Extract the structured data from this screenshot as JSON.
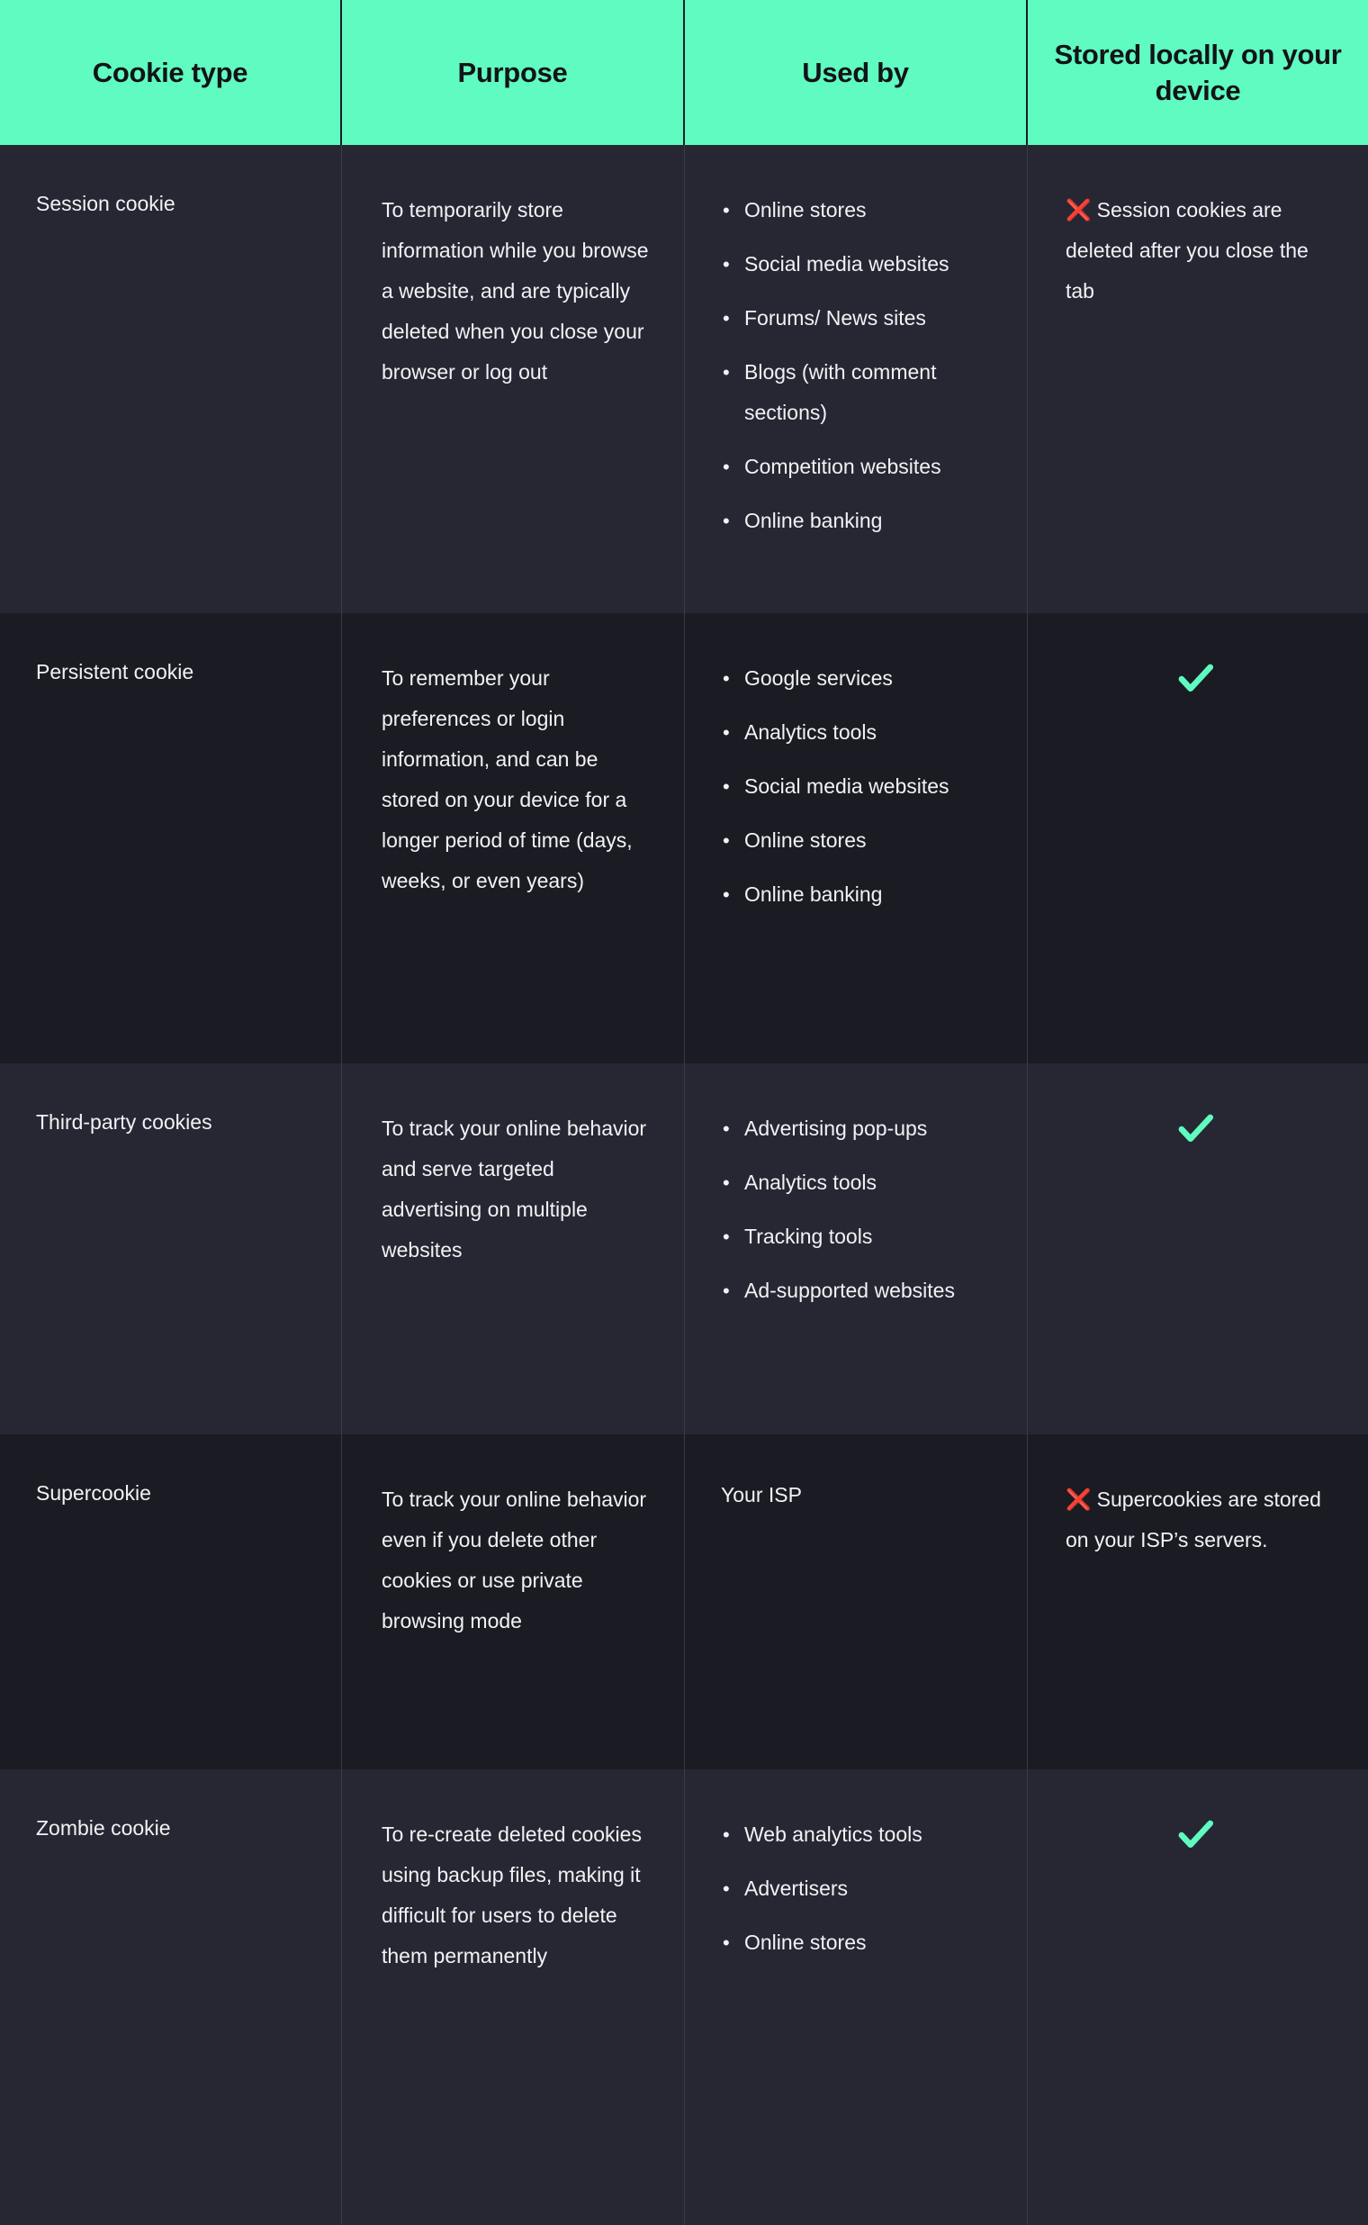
{
  "colors": {
    "header_bg": "#5ffbc0",
    "header_text": "#131318",
    "row_shade_a": "#272733",
    "row_shade_b": "#1b1b24",
    "body_text": "#f2f2f5",
    "divider": "#3a3a48",
    "check_green": "#5ffbc0",
    "cross_red": "#e01b24"
  },
  "header": {
    "columns": [
      {
        "label": "Cookie type"
      },
      {
        "label": "Purpose"
      },
      {
        "label": "Used by"
      },
      {
        "label": "Stored locally on your device"
      }
    ]
  },
  "icons": {
    "cross": "❌",
    "check": "check-icon"
  },
  "rows": [
    {
      "type": "Session cookie",
      "purpose": "To temporarily store information while you browse a website, and are typically deleted when you close your browser or log out",
      "used_by": [
        "Online stores",
        "Social media websites",
        "Forums/ News sites",
        "Blogs (with comment sections)",
        "Competition websites",
        "Online banking"
      ],
      "stored_locally": false,
      "stored_note": "Session cookies are deleted after you close the tab"
    },
    {
      "type": "Persistent cookie",
      "purpose": "To remember your preferences or login information, and can be stored on your device for a longer period of time (days, weeks, or even years)",
      "used_by": [
        "Google services",
        "Analytics tools",
        "Social media websites",
        "Online stores",
        "Online banking"
      ],
      "stored_locally": true,
      "stored_note": ""
    },
    {
      "type": "Third-party cookies",
      "purpose": "To track your online behavior and serve targeted advertising on multiple websites",
      "used_by": [
        "Advertising pop-ups",
        "Analytics tools",
        "Tracking tools",
        "Ad-supported websites"
      ],
      "stored_locally": true,
      "stored_note": ""
    },
    {
      "type": "Supercookie",
      "purpose": "To track your online behavior even if you delete other cookies or use private browsing mode",
      "used_by_plain": "Your ISP",
      "used_by": [],
      "stored_locally": false,
      "stored_note": "Supercookies are stored on your ISP’s servers."
    },
    {
      "type": "Zombie cookie",
      "purpose": "To re-create deleted cookies using backup files, making it difficult for users to delete them permanently",
      "used_by": [
        "Web analytics tools",
        "Advertisers",
        "Online stores"
      ],
      "stored_locally": true,
      "stored_note": ""
    }
  ]
}
